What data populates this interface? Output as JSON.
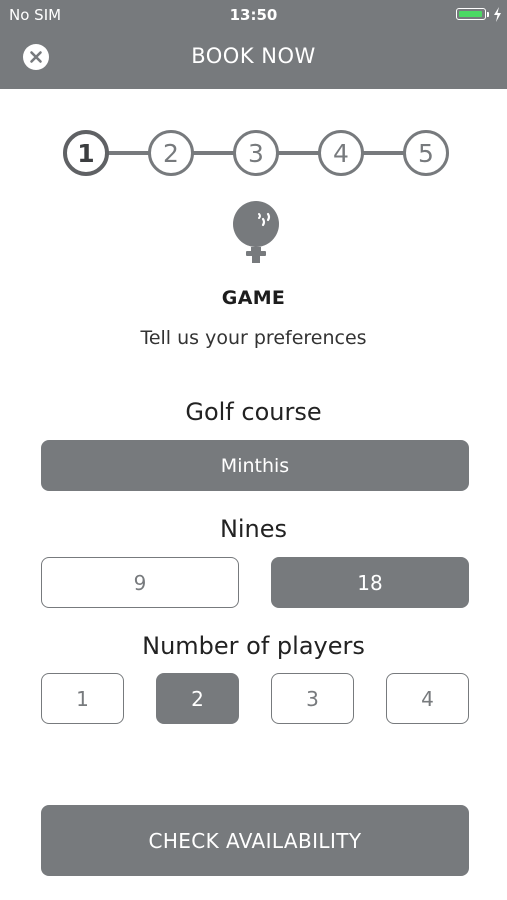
{
  "status_bar": {
    "carrier": "No SIM",
    "time": "13:50",
    "battery_level": 0.9
  },
  "header": {
    "title": "BOOK NOW",
    "close_icon": "close-icon"
  },
  "stepper": {
    "steps": [
      "1",
      "2",
      "3",
      "4",
      "5"
    ],
    "active_step": 1
  },
  "section": {
    "icon": "golf-ball-on-tee-icon",
    "title": "GAME",
    "subtitle": "Tell us your preferences"
  },
  "golf_course": {
    "label": "Golf course",
    "value": "Minthis"
  },
  "nines": {
    "label": "Nines",
    "options": [
      "9",
      "18"
    ],
    "selected": "18"
  },
  "players": {
    "label": "Number of players",
    "options": [
      "1",
      "2",
      "3",
      "4"
    ],
    "selected": "2"
  },
  "cta": {
    "label": "CHECK AVAILABILITY"
  },
  "colors": {
    "primary": "#777a7d",
    "battery": "#4cd964",
    "background": "#ffffff"
  }
}
